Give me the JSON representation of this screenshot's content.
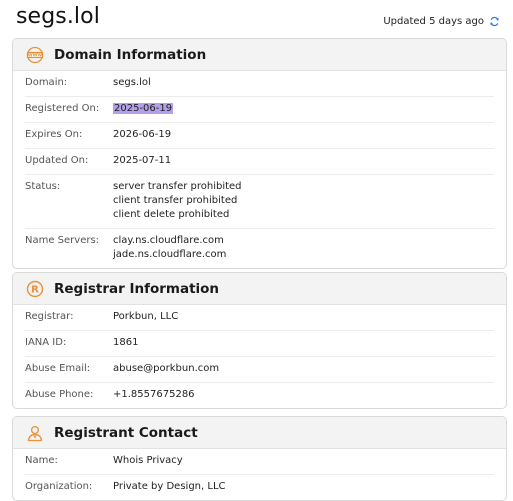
{
  "header": {
    "site_title": "segs.lol",
    "updated_text": "Updated 5 days ago"
  },
  "domain_info": {
    "title": "Domain Information",
    "icon": "www-globe-icon",
    "rows": [
      {
        "label": "Domain:",
        "value": "segs.lol"
      },
      {
        "label": "Registered On:",
        "value": "2025-06-19"
      },
      {
        "label": "Expires On:",
        "value": "2026-06-19"
      },
      {
        "label": "Updated On:",
        "value": "2025-07-11"
      }
    ],
    "status_label": "Status:",
    "status_values": [
      "server transfer prohibited",
      "client transfer prohibited",
      "client delete prohibited"
    ],
    "ns_label": "Name Servers:",
    "ns_values": [
      "clay.ns.cloudflare.com",
      "jade.ns.cloudflare.com"
    ]
  },
  "registrar_info": {
    "title": "Registrar Information",
    "icon": "registered-trademark-icon",
    "rows": [
      {
        "label": "Registrar:",
        "value": "Porkbun, LLC"
      },
      {
        "label": "IANA ID:",
        "value": "1861"
      },
      {
        "label": "Abuse Email:",
        "value": "abuse@porkbun.com"
      },
      {
        "label": "Abuse Phone:",
        "value": "+1.8557675286"
      }
    ]
  },
  "registrant_contact": {
    "title": "Registrant Contact",
    "icon": "person-icon",
    "rows": [
      {
        "label": "Name:",
        "value": "Whois Privacy"
      },
      {
        "label": "Organization:",
        "value": "Private by Design, LLC"
      }
    ]
  },
  "colors": {
    "accent": "#e8913a",
    "refresh": "#2a7fd4",
    "highlight": "#b4a0e8"
  }
}
